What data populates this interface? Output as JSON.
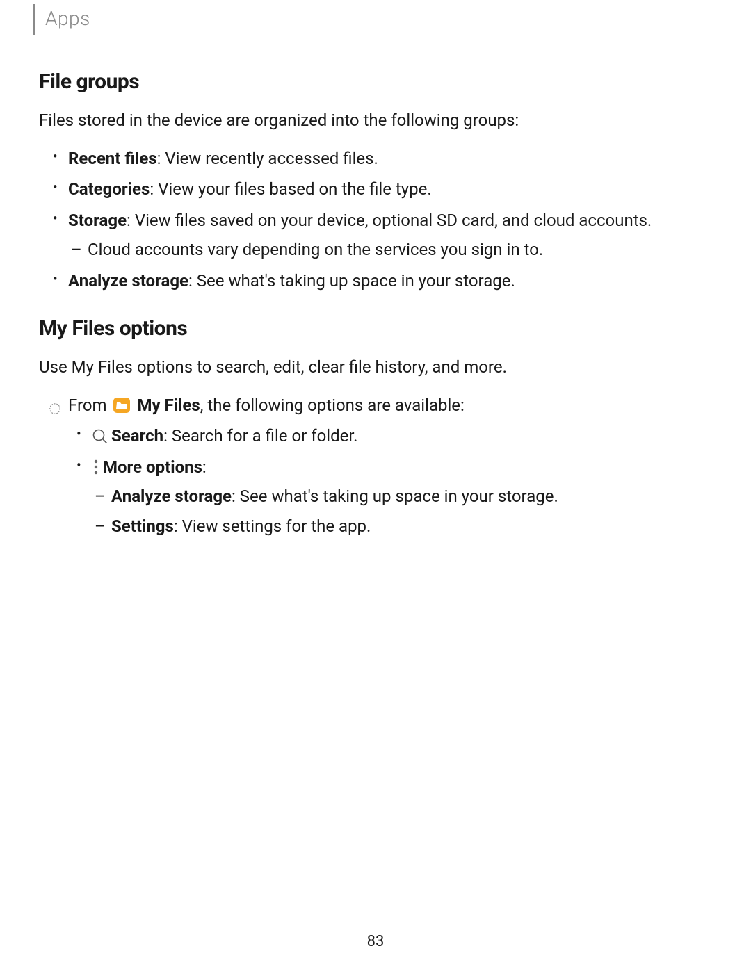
{
  "header": {
    "label": "Apps"
  },
  "section1": {
    "heading": "File groups",
    "intro": "Files stored in the device are organized into the following groups:",
    "items": [
      {
        "term": "Recent files",
        "desc": ": View recently accessed files."
      },
      {
        "term": "Categories",
        "desc": ": View your files based on the file type."
      },
      {
        "term": "Storage",
        "desc": ": View files saved on your device, optional SD card, and cloud accounts.",
        "sub": [
          {
            "text": "Cloud accounts vary depending on the services you sign in to."
          }
        ]
      },
      {
        "term": "Analyze storage",
        "desc": ": See what's taking up space in your storage."
      }
    ]
  },
  "section2": {
    "heading": "My Files options",
    "intro": "Use My Files options to search, edit, clear file history, and more.",
    "from_prefix": "From ",
    "from_app": "My Files",
    "from_suffix": ", the following options are available:",
    "options": [
      {
        "icon": "search",
        "term": "Search",
        "desc": ": Search for a file or folder."
      },
      {
        "icon": "more",
        "term": "More options",
        "desc": ":",
        "sub": [
          {
            "term": "Analyze storage",
            "desc": ": See what's taking up space in your storage."
          },
          {
            "term": "Settings",
            "desc": ": View settings for the app."
          }
        ]
      }
    ]
  },
  "page_number": "83"
}
